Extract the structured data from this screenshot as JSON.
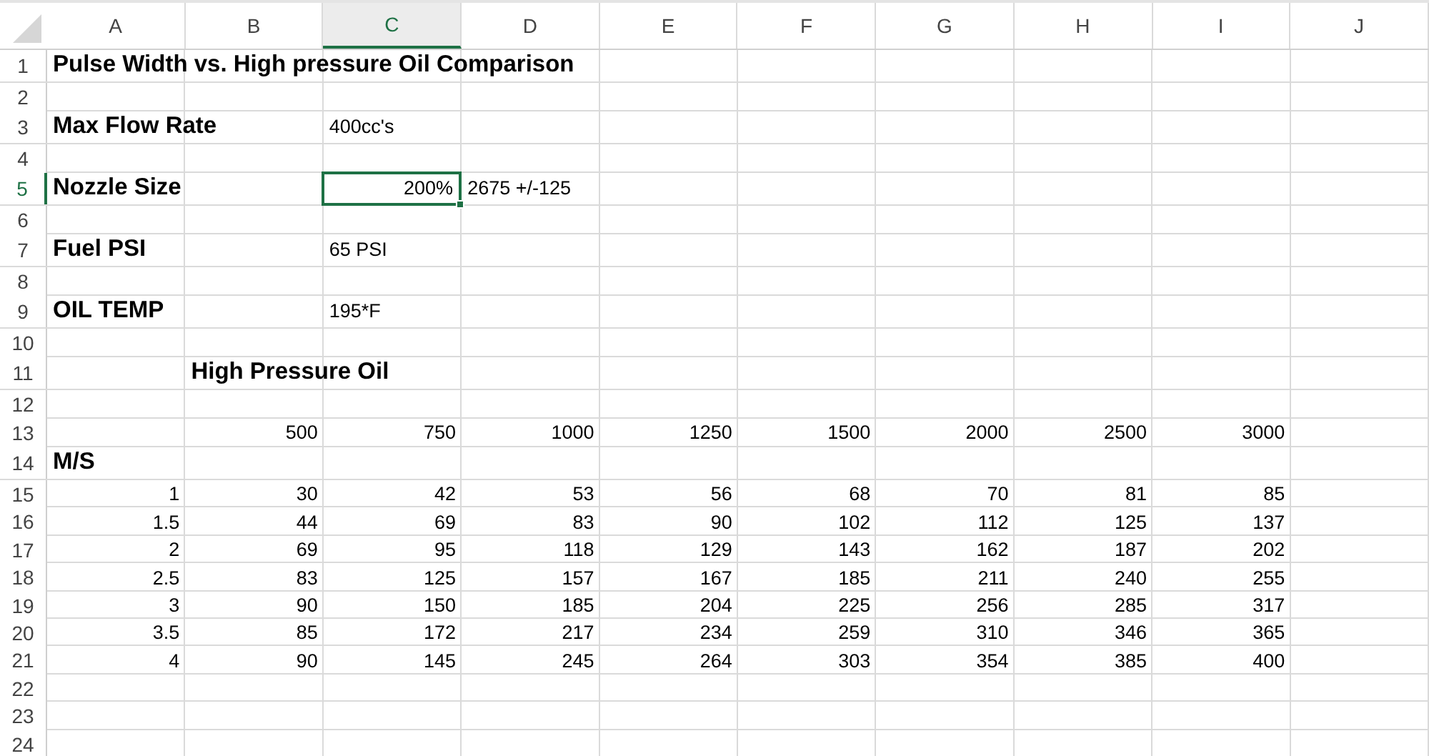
{
  "columns": [
    {
      "label": "A",
      "selected": false
    },
    {
      "label": "B",
      "selected": false
    },
    {
      "label": "C",
      "selected": true
    },
    {
      "label": "D",
      "selected": false
    },
    {
      "label": "E",
      "selected": false
    },
    {
      "label": "F",
      "selected": false
    },
    {
      "label": "G",
      "selected": false
    },
    {
      "label": "H",
      "selected": false
    },
    {
      "label": "I",
      "selected": false
    },
    {
      "label": "J",
      "selected": false
    }
  ],
  "rows": [
    {
      "number": "1",
      "selected": false,
      "cells": [
        {
          "text": "Pulse Width vs. High pressure Oil Comparison",
          "kind": "label"
        }
      ]
    },
    {
      "number": "2",
      "selected": false
    },
    {
      "number": "3",
      "selected": false,
      "cells": [
        {
          "text": "Max Flow Rate",
          "kind": "label"
        },
        null,
        {
          "text": "400cc's",
          "kind": "text"
        }
      ]
    },
    {
      "number": "4",
      "selected": false
    },
    {
      "number": "5",
      "selected": true,
      "cells": [
        {
          "text": "Nozzle Size",
          "kind": "label"
        },
        null,
        {
          "text": "200%",
          "kind": "number"
        },
        {
          "text": "2675 +/-125",
          "kind": "text"
        }
      ]
    },
    {
      "number": "6",
      "selected": false
    },
    {
      "number": "7",
      "selected": false,
      "cells": [
        {
          "text": "Fuel PSI",
          "kind": "label"
        },
        null,
        {
          "text": "65 PSI",
          "kind": "text"
        }
      ]
    },
    {
      "number": "8",
      "selected": false
    },
    {
      "number": "9",
      "selected": false,
      "cells": [
        {
          "text": "OIL TEMP",
          "kind": "label"
        },
        null,
        {
          "text": "195*F",
          "kind": "text"
        }
      ]
    },
    {
      "number": "10",
      "selected": false
    },
    {
      "number": "11",
      "selected": false,
      "cells": [
        null,
        {
          "text": "High Pressure Oil",
          "kind": "label"
        }
      ]
    },
    {
      "number": "12",
      "selected": false
    },
    {
      "number": "13",
      "selected": false,
      "cells": [
        null,
        {
          "text": "500",
          "kind": "number"
        },
        {
          "text": "750",
          "kind": "number"
        },
        {
          "text": "1000",
          "kind": "number"
        },
        {
          "text": "1250",
          "kind": "number"
        },
        {
          "text": "1500",
          "kind": "number"
        },
        {
          "text": "2000",
          "kind": "number"
        },
        {
          "text": "2500",
          "kind": "number"
        },
        {
          "text": "3000",
          "kind": "number"
        }
      ]
    },
    {
      "number": "14",
      "selected": false,
      "cells": [
        {
          "text": "M/S",
          "kind": "label"
        }
      ]
    },
    {
      "number": "15",
      "selected": false,
      "cells": [
        {
          "text": "1",
          "kind": "number"
        },
        {
          "text": "30",
          "kind": "number"
        },
        {
          "text": "42",
          "kind": "number"
        },
        {
          "text": "53",
          "kind": "number"
        },
        {
          "text": "56",
          "kind": "number"
        },
        {
          "text": "68",
          "kind": "number"
        },
        {
          "text": "70",
          "kind": "number"
        },
        {
          "text": "81",
          "kind": "number"
        },
        {
          "text": "85",
          "kind": "number"
        }
      ]
    },
    {
      "number": "16",
      "selected": false,
      "cells": [
        {
          "text": "1.5",
          "kind": "number"
        },
        {
          "text": "44",
          "kind": "number"
        },
        {
          "text": "69",
          "kind": "number"
        },
        {
          "text": "83",
          "kind": "number"
        },
        {
          "text": "90",
          "kind": "number"
        },
        {
          "text": "102",
          "kind": "number"
        },
        {
          "text": "112",
          "kind": "number"
        },
        {
          "text": "125",
          "kind": "number"
        },
        {
          "text": "137",
          "kind": "number"
        }
      ]
    },
    {
      "number": "17",
      "selected": false,
      "cells": [
        {
          "text": "2",
          "kind": "number"
        },
        {
          "text": "69",
          "kind": "number"
        },
        {
          "text": "95",
          "kind": "number"
        },
        {
          "text": "118",
          "kind": "number"
        },
        {
          "text": "129",
          "kind": "number"
        },
        {
          "text": "143",
          "kind": "number"
        },
        {
          "text": "162",
          "kind": "number"
        },
        {
          "text": "187",
          "kind": "number"
        },
        {
          "text": "202",
          "kind": "number"
        }
      ]
    },
    {
      "number": "18",
      "selected": false,
      "cells": [
        {
          "text": "2.5",
          "kind": "number"
        },
        {
          "text": "83",
          "kind": "number"
        },
        {
          "text": "125",
          "kind": "number"
        },
        {
          "text": "157",
          "kind": "number"
        },
        {
          "text": "167",
          "kind": "number"
        },
        {
          "text": "185",
          "kind": "number"
        },
        {
          "text": "211",
          "kind": "number"
        },
        {
          "text": "240",
          "kind": "number"
        },
        {
          "text": "255",
          "kind": "number"
        }
      ]
    },
    {
      "number": "19",
      "selected": false,
      "cells": [
        {
          "text": "3",
          "kind": "number"
        },
        {
          "text": "90",
          "kind": "number"
        },
        {
          "text": "150",
          "kind": "number"
        },
        {
          "text": "185",
          "kind": "number"
        },
        {
          "text": "204",
          "kind": "number"
        },
        {
          "text": "225",
          "kind": "number"
        },
        {
          "text": "256",
          "kind": "number"
        },
        {
          "text": "285",
          "kind": "number"
        },
        {
          "text": "317",
          "kind": "number"
        }
      ]
    },
    {
      "number": "20",
      "selected": false,
      "cells": [
        {
          "text": "3.5",
          "kind": "number"
        },
        {
          "text": "85",
          "kind": "number"
        },
        {
          "text": "172",
          "kind": "number"
        },
        {
          "text": "217",
          "kind": "number"
        },
        {
          "text": "234",
          "kind": "number"
        },
        {
          "text": "259",
          "kind": "number"
        },
        {
          "text": "310",
          "kind": "number"
        },
        {
          "text": "346",
          "kind": "number"
        },
        {
          "text": "365",
          "kind": "number"
        }
      ]
    },
    {
      "number": "21",
      "selected": false,
      "cells": [
        {
          "text": "4",
          "kind": "number"
        },
        {
          "text": "90",
          "kind": "number"
        },
        {
          "text": "145",
          "kind": "number"
        },
        {
          "text": "245",
          "kind": "number"
        },
        {
          "text": "264",
          "kind": "number"
        },
        {
          "text": "303",
          "kind": "number"
        },
        {
          "text": "354",
          "kind": "number"
        },
        {
          "text": "385",
          "kind": "number"
        },
        {
          "text": "400",
          "kind": "number"
        }
      ]
    },
    {
      "number": "22",
      "selected": false
    },
    {
      "number": "23",
      "selected": false
    },
    {
      "number": "24",
      "selected": false
    }
  ]
}
